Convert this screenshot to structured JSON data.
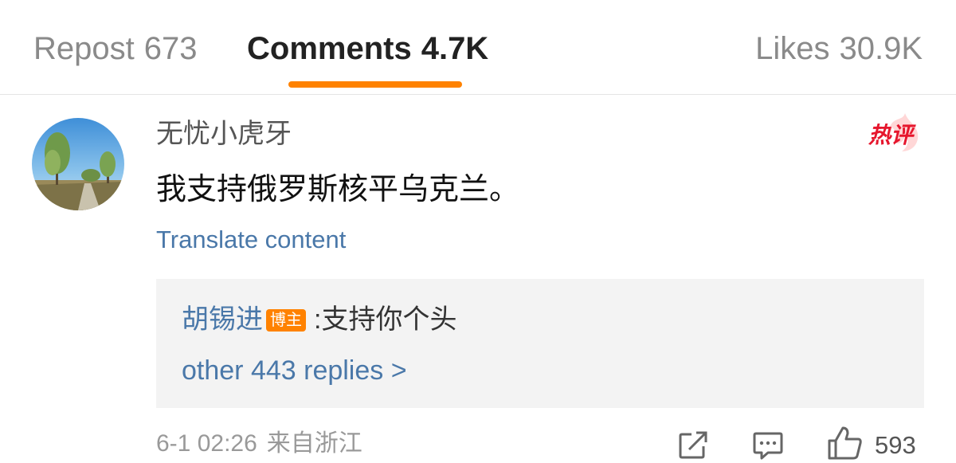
{
  "tabs": [
    {
      "label": "Repost",
      "count": "673",
      "active": false
    },
    {
      "label": "Comments",
      "count": "4.7K",
      "active": true
    },
    {
      "label": "Likes",
      "count": "30.9K",
      "active": false
    }
  ],
  "accent_color": "#ff8200",
  "link_color": "#4a78a9",
  "comment": {
    "username": "无忧小虎牙",
    "hot_badge": "热评",
    "text": "我支持俄罗斯核平乌克兰。",
    "translate_label": "Translate content",
    "reply": {
      "author": "胡锡进",
      "author_badge": "博主",
      "separator": ":",
      "text": "支持你个头",
      "more_label": "other 443 replies >"
    },
    "date": "6-1 02:26",
    "location": "来自浙江",
    "like_count": "593",
    "icons": [
      "repost-icon",
      "comment-icon",
      "thumbs-up-icon"
    ]
  }
}
